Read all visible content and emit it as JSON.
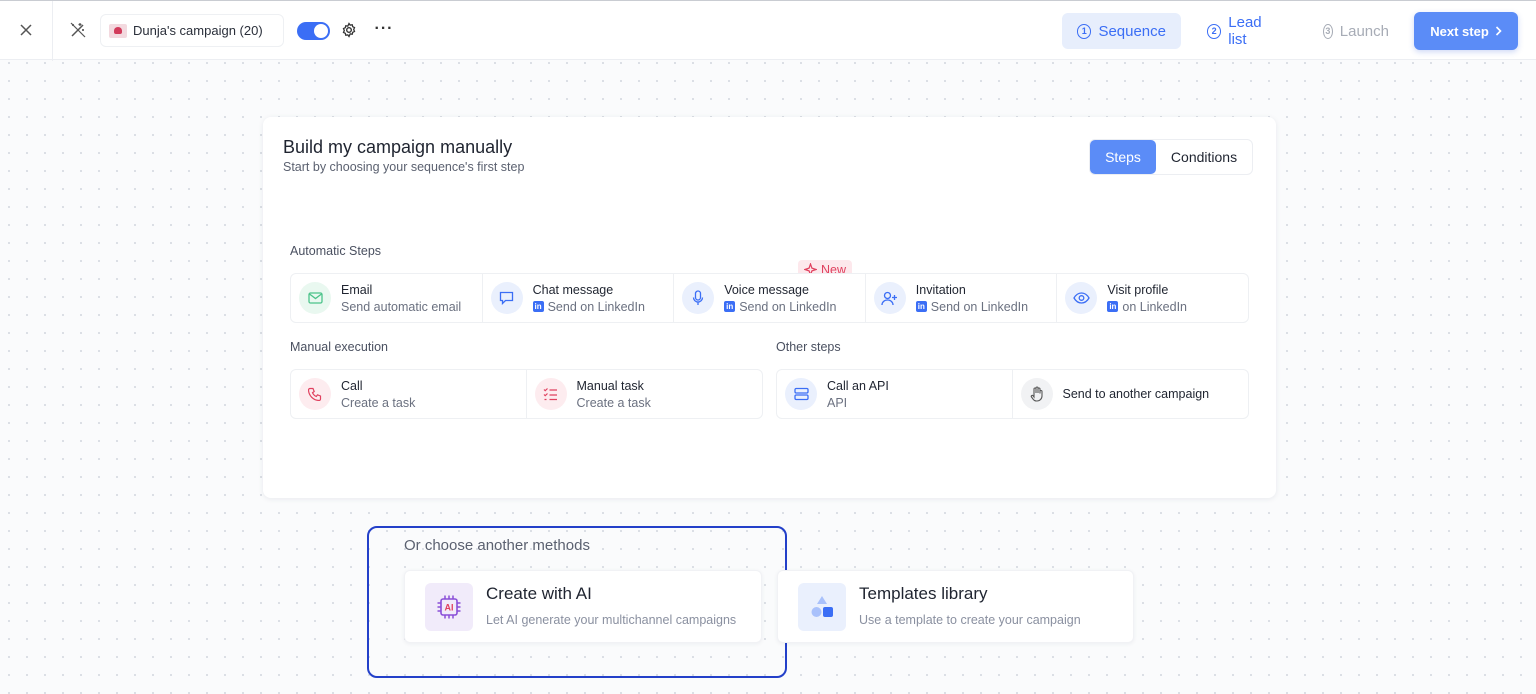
{
  "topbar": {
    "campaign_name": "Dunja's campaign (20)",
    "toggle_on": true,
    "steps": [
      {
        "num": "1",
        "label": "Sequence",
        "state": "active"
      },
      {
        "num": "2",
        "label": "Lead list",
        "state": "enabled"
      },
      {
        "num": "3",
        "label": "Launch",
        "state": "disabled"
      }
    ],
    "next_label": "Next step"
  },
  "card": {
    "title": "Build my campaign manually",
    "subtitle": "Start by choosing your sequence's first step",
    "tabs": {
      "steps": "Steps",
      "conditions": "Conditions"
    },
    "automatic_label": "Automatic Steps",
    "new_badge": "New",
    "automatic": [
      {
        "title": "Email",
        "desc": "Send automatic email",
        "icon": "mail-icon"
      },
      {
        "title": "Chat message",
        "desc": "Send on LinkedIn",
        "icon": "chat-icon"
      },
      {
        "title": "Voice message",
        "desc": "Send on LinkedIn",
        "icon": "microphone-icon"
      },
      {
        "title": "Invitation",
        "desc": "Send on LinkedIn",
        "icon": "user-plus-icon"
      },
      {
        "title": "Visit profile",
        "desc": "on LinkedIn",
        "icon": "eye-icon"
      }
    ],
    "manual_label": "Manual execution",
    "manual": [
      {
        "title": "Call",
        "desc": "Create a task",
        "icon": "phone-icon"
      },
      {
        "title": "Manual task",
        "desc": "Create a task",
        "icon": "checklist-icon"
      }
    ],
    "other_label": "Other steps",
    "other": [
      {
        "title": "Call an API",
        "desc": "API",
        "icon": "server-icon"
      },
      {
        "title": "Send to another campaign",
        "icon": "hand-icon"
      }
    ]
  },
  "methods": {
    "label": "Or choose another methods",
    "ai": {
      "title": "Create with AI",
      "desc": "Let AI generate your multichannel campaigns"
    },
    "templates": {
      "title": "Templates library",
      "desc": "Use a template to create your campaign"
    }
  },
  "colors": {
    "accent": "#3b6ef5",
    "highlight_border": "#2340c9"
  }
}
